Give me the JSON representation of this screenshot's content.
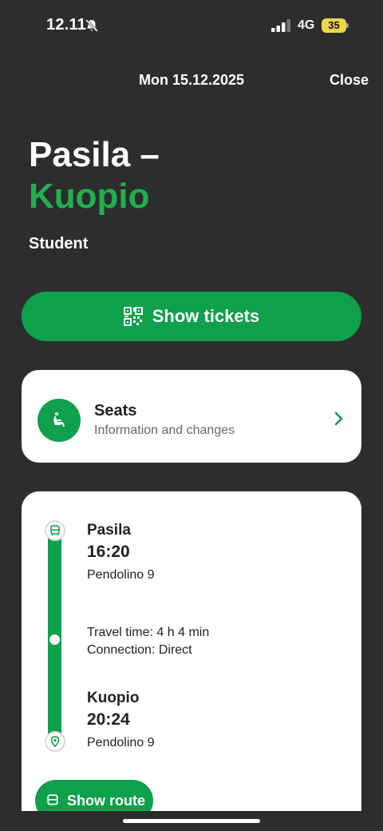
{
  "status_bar": {
    "time": "12.11",
    "network": "4G",
    "battery": "35",
    "icons": [
      "bell-muted-icon",
      "signal-icon",
      "battery-icon"
    ]
  },
  "header": {
    "date": "Mon 15.12.2025",
    "close_label": "Close"
  },
  "route": {
    "from": "Pasila –",
    "to": "Kuopio",
    "passenger_type": "Student"
  },
  "actions": {
    "show_tickets_label": "Show tickets",
    "show_route_label": "Show route"
  },
  "seats": {
    "title": "Seats",
    "subtitle": "Information and changes"
  },
  "journey": {
    "departure": {
      "station": "Pasila",
      "time": "16:20",
      "train": "Pendolino 9"
    },
    "travel_time": "Travel time: 4 h 4 min",
    "connection": "Connection: Direct",
    "arrival": {
      "station": "Kuopio",
      "time": "20:24",
      "train": "Pendolino 9"
    }
  },
  "colors": {
    "background": "#2d2d2d",
    "accent_green": "#0ea04b",
    "title_green": "#1fb14f",
    "card": "#ffffff",
    "battery": "#f1d54a"
  }
}
